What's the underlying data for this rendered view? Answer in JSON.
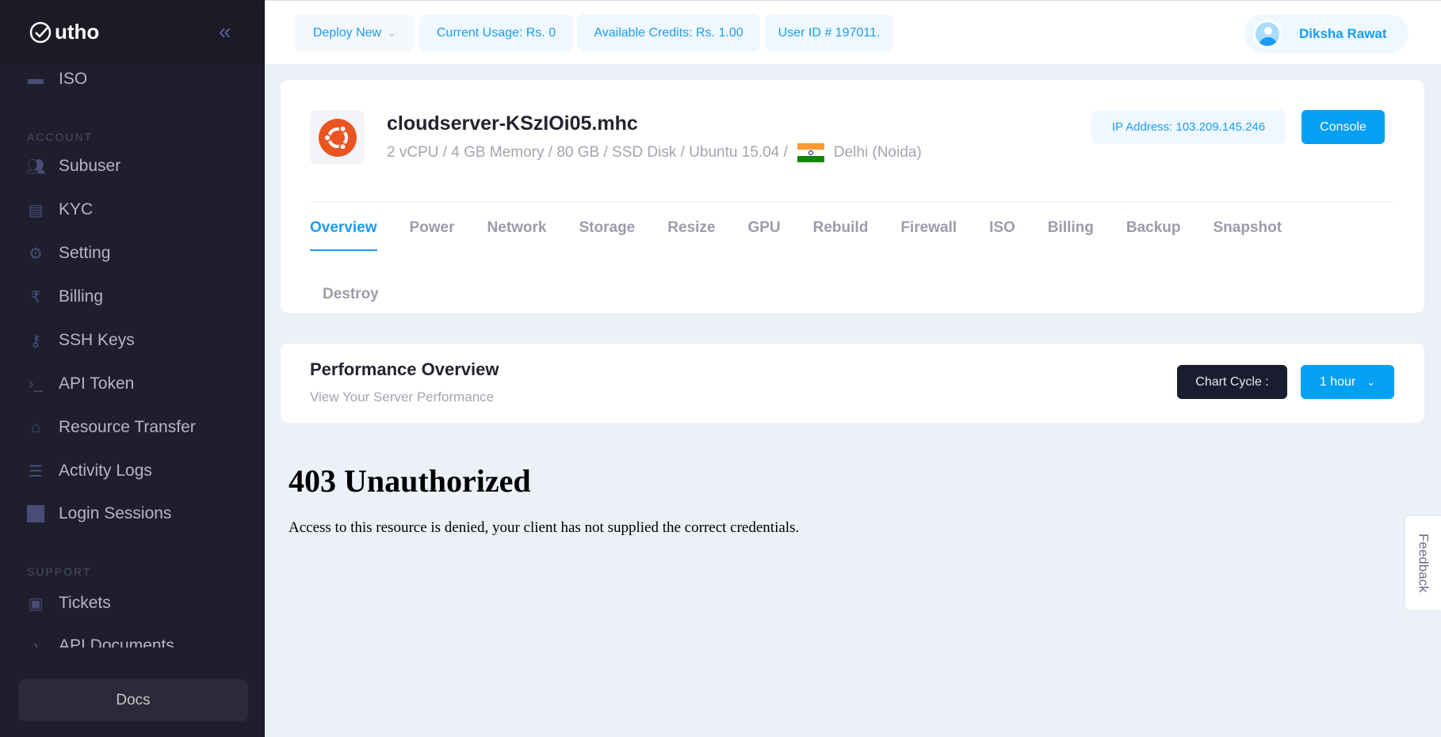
{
  "sidebar": {
    "brand": "utho",
    "sections": {
      "account": "ACCOUNT",
      "support": "SUPPORT"
    },
    "items": [
      {
        "label": "ISO",
        "icon": "disc-icon"
      },
      {
        "label": "Subuser",
        "icon": "users-icon"
      },
      {
        "label": "KYC",
        "icon": "id-document-icon"
      },
      {
        "label": "Setting",
        "icon": "gear-icon"
      },
      {
        "label": "Billing",
        "icon": "rupee-icon"
      },
      {
        "label": "SSH Keys",
        "icon": "key-icon"
      },
      {
        "label": "API Token",
        "icon": "terminal-icon"
      },
      {
        "label": "Resource Transfer",
        "icon": "transfer-icon"
      },
      {
        "label": "Activity Logs",
        "icon": "sliders-icon"
      },
      {
        "label": "Login Sessions",
        "icon": "session-icon"
      },
      {
        "label": "Tickets",
        "icon": "chat-icon"
      },
      {
        "label": "API Documents",
        "icon": "terminal-icon"
      }
    ],
    "docs": "Docs"
  },
  "header": {
    "deploy": "Deploy New",
    "usage": "Current Usage: Rs. 0",
    "credits": "Available Credits: Rs. 1.00",
    "user_id": "User ID # 197011.",
    "user_name": "Diksha Rawat"
  },
  "server": {
    "name": "cloudserver-KSzIOi05.mhc",
    "specs": "2 vCPU / 4 GB Memory / 80 GB / SSD Disk / Ubuntu 15.04 /",
    "location": "Delhi (Noida)",
    "ip": "IP Address: 103.209.145.246",
    "console": "Console",
    "tabs": [
      "Overview",
      "Power",
      "Network",
      "Storage",
      "Resize",
      "GPU",
      "Rebuild",
      "Firewall",
      "ISO",
      "Billing",
      "Backup",
      "Snapshot",
      "Destroy"
    ],
    "active_tab": "Overview"
  },
  "performance": {
    "title": "Performance Overview",
    "subtitle": "View Your Server Performance",
    "chart_cycle_label": "Chart Cycle :",
    "chart_cycle_value": "1 hour"
  },
  "error": {
    "title": "403 Unauthorized",
    "message": "Access to this resource is denied, your client has not supplied the correct credentials."
  },
  "feedback": "Feedback",
  "colors": {
    "accent": "#03a0f4",
    "sidebar": "#1f1e2c",
    "ubuntu": "#e95420"
  }
}
